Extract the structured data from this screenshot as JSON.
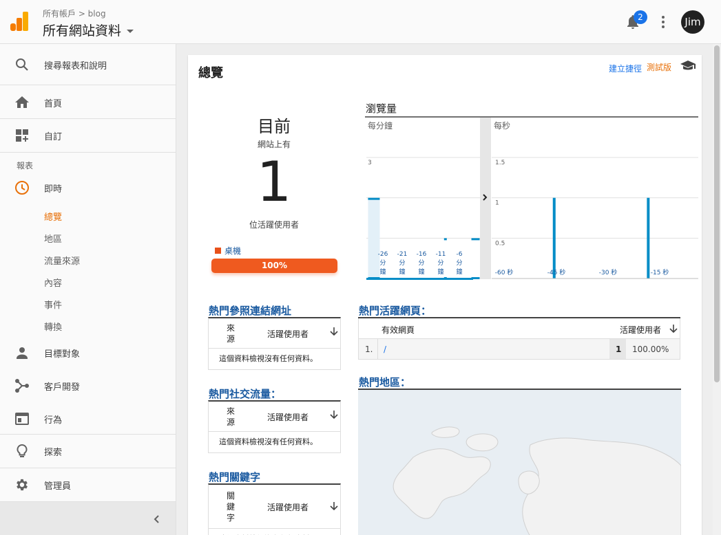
{
  "header": {
    "breadcrumb": "所有帳戶 > blog",
    "property": "所有網站資料",
    "notification_count": "2",
    "user": "Jim"
  },
  "sidebar": {
    "search": "搜尋報表和說明",
    "home": "首頁",
    "custom": "自訂",
    "reports_label": "報表",
    "realtime": "即時",
    "realtime_items": [
      "總覽",
      "地區",
      "流量來源",
      "內容",
      "事件",
      "轉換"
    ],
    "audience": "目標對象",
    "acquisition": "客戶開發",
    "behavior": "行為",
    "discover": "探索",
    "admin": "管理員"
  },
  "main": {
    "title": "總覽",
    "shortcut": "建立捷徑",
    "beta": "測試版",
    "now_label": "目前",
    "now_sub": "網站上有",
    "active_users": "1",
    "active_label": "位活躍使用者",
    "device_label": "桌機",
    "device_percent": "100%",
    "views_title": "瀏覽量",
    "per_minute": "每分鐘",
    "per_second": "每秒",
    "referrals_title": "熱門參照連結網址",
    "social_title": "熱門社交流量：",
    "keywords_title": "熱門關鍵字",
    "col_source": "來源",
    "col_keyword": "關鍵字",
    "col_active": "活躍使用者",
    "empty_msg": "這個資料檢視沒有任何資料。",
    "pages_title": "熱門活躍網頁：",
    "col_page": "有效網頁",
    "pages": [
      {
        "idx": "1.",
        "path": "/",
        "count": "1",
        "pct": "100.00%"
      }
    ],
    "locations_title": "熱門地區："
  },
  "chart_data": [
    {
      "type": "bar",
      "title": "每分鐘",
      "ylim": [
        0,
        3
      ],
      "yticks": [
        "1",
        "2",
        "3"
      ],
      "categories": [
        "-26 分鐘",
        "-21 分鐘",
        "-16 分鐘",
        "-11 分鐘",
        "-6 分鐘"
      ],
      "x": [
        -28,
        -9,
        -1
      ],
      "values": [
        2,
        1,
        1
      ]
    },
    {
      "type": "bar",
      "title": "每秒",
      "ylim": [
        0,
        1.5
      ],
      "yticks": [
        "0.5",
        "1",
        "1.5"
      ],
      "categories": [
        "-60 秒",
        "-45 秒",
        "-30 秒",
        "-15 秒"
      ],
      "x": [
        -44,
        -15
      ],
      "values": [
        1,
        1
      ]
    }
  ],
  "colors": {
    "accent": "#e8710a",
    "link": "#1a73e8",
    "bar": "#058dc7",
    "device": "#ef5a1f"
  }
}
